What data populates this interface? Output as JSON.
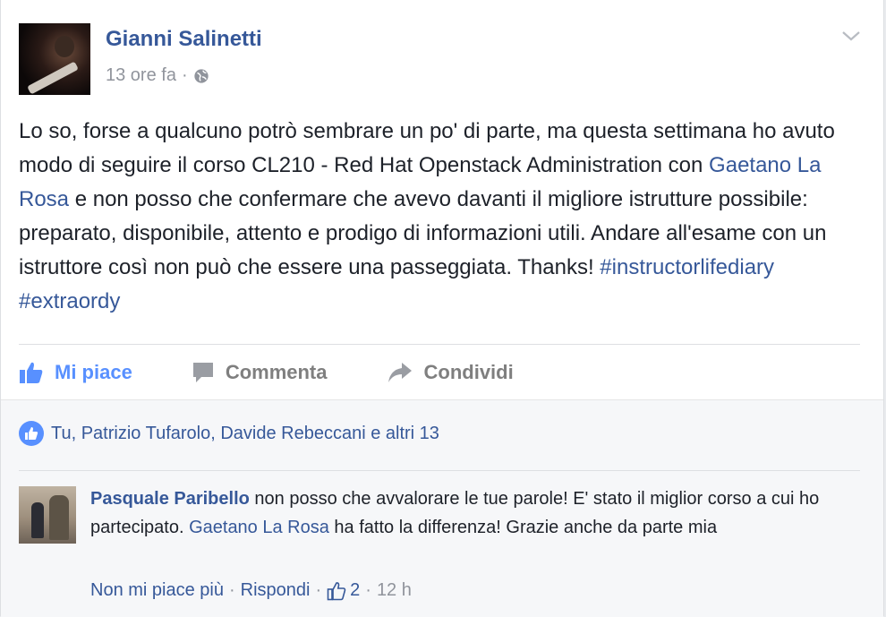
{
  "post": {
    "author": "Gianni Salinetti",
    "time": "13 ore fa",
    "dot": "·",
    "text_1": "Lo so, forse a qualcuno potrò sembrare un po' di parte, ma questa settimana ho avuto modo di seguire il corso CL210 - Red Hat Openstack Administration con ",
    "mention": "Gaetano La Rosa",
    "text_2": " e non posso che confermare che avevo davanti il migliore istrutture possibile: preparato, disponibile, attento e prodigo di informazioni utili. Andare all'esame con un istruttore così non può che essere una passeggiata. Thanks! ",
    "hashtag_1": "#instructorlifediary",
    "hashtag_2": "#extraordy"
  },
  "actions": {
    "like": "Mi piace",
    "comment": "Commenta",
    "share": "Condividi"
  },
  "likes": {
    "text": "Tu, Patrizio Tufarolo, Davide Rebeccani e altri 13"
  },
  "comment": {
    "author": "Pasquale Paribello",
    "text_1": " non posso che avvalorare le tue parole! E' stato il miglior corso a cui ho partecipato. ",
    "mention": "Gaetano La Rosa",
    "text_2": " ha fatto la differenza! Grazie anche da parte mia",
    "unlike": "Non mi piace più",
    "reply": "Rispondi",
    "like_count": "2",
    "time": "12 h",
    "sep": "·"
  },
  "icons": {
    "globe": "globe-icon",
    "chevron": "chevron-down-icon",
    "like": "thumbs-up-icon",
    "comment": "comment-bubble-icon",
    "share": "share-arrow-icon"
  },
  "colors": {
    "link": "#365899",
    "like_blue": "#5890ff",
    "muted": "#90949c"
  }
}
